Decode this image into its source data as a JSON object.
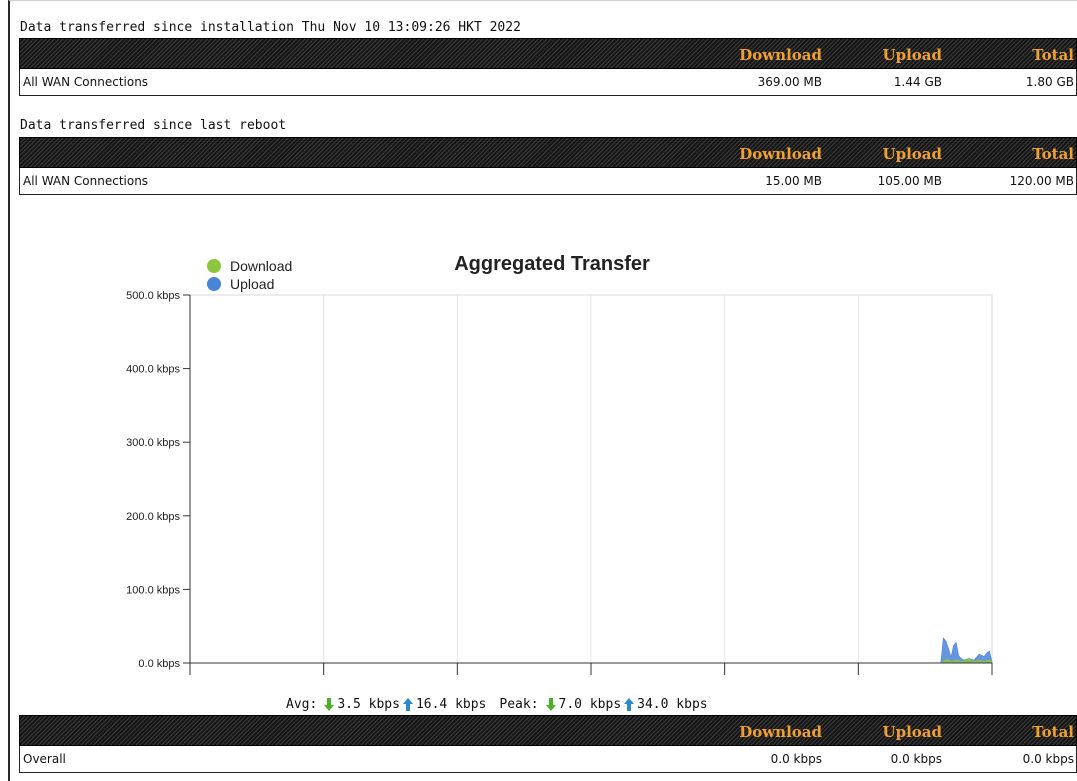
{
  "section1": {
    "caption": "Data transferred since installation Thu Nov 10 13:09:26 HKT 2022",
    "headers": {
      "download": "Download",
      "upload": "Upload",
      "total": "Total"
    },
    "row": {
      "label": "All WAN Connections",
      "download": "369.00 MB",
      "upload": "1.44 GB",
      "total": "1.80 GB"
    }
  },
  "section2": {
    "caption": "Data transferred since last reboot",
    "headers": {
      "download": "Download",
      "upload": "Upload",
      "total": "Total"
    },
    "row": {
      "label": "All WAN Connections",
      "download": "15.00 MB",
      "upload": "105.00 MB",
      "total": "120.00 MB"
    }
  },
  "chart_data": {
    "type": "area",
    "title": "Aggregated Transfer",
    "legend_position": "top-left",
    "series": [
      {
        "name": "Download",
        "color": "#8cc63f",
        "values": [
          0,
          0,
          0,
          0,
          0,
          0,
          0,
          0,
          0,
          0,
          0,
          0,
          0,
          0,
          0,
          0,
          0,
          0,
          0,
          0,
          0,
          0,
          0,
          0,
          0,
          0,
          0,
          0,
          0,
          0,
          0,
          0,
          0,
          0,
          0,
          0,
          0,
          0,
          0,
          0,
          0,
          0,
          0,
          0,
          0,
          0,
          0,
          0,
          0,
          0,
          0,
          0,
          0,
          0,
          0,
          0,
          0,
          0,
          0,
          0,
          0,
          0,
          0,
          0,
          0,
          0,
          0,
          0,
          0,
          0,
          0,
          0,
          0,
          0,
          0,
          0,
          0,
          0,
          0,
          0,
          0,
          0,
          0,
          0,
          0,
          0,
          0,
          0,
          0,
          0,
          0,
          0,
          0,
          0,
          0,
          0,
          0,
          0,
          0,
          0,
          0,
          0,
          0,
          0,
          0,
          0,
          0,
          0,
          0,
          0,
          0,
          0,
          0,
          0,
          0,
          0,
          0,
          0,
          0,
          0,
          0,
          0,
          0,
          0,
          0,
          0,
          0,
          0,
          0,
          0,
          0,
          0,
          0,
          0,
          0,
          0,
          0,
          0,
          0,
          0,
          0,
          0,
          0,
          0,
          0,
          0,
          0,
          0,
          0,
          0,
          0,
          0,
          0,
          0,
          0,
          0,
          0,
          0,
          0,
          0,
          0,
          0,
          0,
          0,
          0,
          0,
          0,
          0,
          0,
          0,
          0,
          0,
          0,
          0,
          0,
          0,
          0,
          0,
          0,
          0,
          0,
          0,
          0,
          0,
          0,
          0,
          0,
          0,
          0,
          0,
          0,
          0,
          0,
          0,
          0,
          0,
          0,
          0,
          0,
          0,
          0,
          0,
          0,
          0,
          0,
          0,
          0,
          0,
          0,
          0,
          0,
          0,
          0,
          0,
          0,
          0,
          0,
          0,
          0,
          0,
          0,
          0,
          0,
          0,
          0,
          0,
          0,
          0,
          0,
          0,
          0,
          0,
          0,
          0,
          0,
          0,
          0,
          0,
          0,
          0,
          0,
          0,
          0,
          0,
          0,
          0,
          0,
          0,
          0,
          0,
          0,
          0,
          0,
          0,
          0,
          0,
          0,
          0,
          0,
          0,
          0,
          0,
          0,
          0,
          0,
          0,
          0,
          0,
          0,
          0,
          0,
          0,
          0,
          0,
          0,
          0,
          0,
          0,
          0,
          0,
          0,
          0,
          0,
          0,
          0,
          0,
          0,
          0,
          0,
          0,
          0,
          0,
          0,
          0,
          0,
          0,
          0,
          0,
          3,
          5,
          4,
          2,
          3,
          4,
          3,
          2,
          3,
          4,
          7,
          3,
          2,
          3,
          4,
          3,
          2,
          3,
          4,
          3
        ]
      },
      {
        "name": "Upload",
        "color": "#4a84d8",
        "values": [
          0,
          0,
          0,
          0,
          0,
          0,
          0,
          0,
          0,
          0,
          0,
          0,
          0,
          0,
          0,
          0,
          0,
          0,
          0,
          0,
          0,
          0,
          0,
          0,
          0,
          0,
          0,
          0,
          0,
          0,
          0,
          0,
          0,
          0,
          0,
          0,
          0,
          0,
          0,
          0,
          0,
          0,
          0,
          0,
          0,
          0,
          0,
          0,
          0,
          0,
          0,
          0,
          0,
          0,
          0,
          0,
          0,
          0,
          0,
          0,
          0,
          0,
          0,
          0,
          0,
          0,
          0,
          0,
          0,
          0,
          0,
          0,
          0,
          0,
          0,
          0,
          0,
          0,
          0,
          0,
          0,
          0,
          0,
          0,
          0,
          0,
          0,
          0,
          0,
          0,
          0,
          0,
          0,
          0,
          0,
          0,
          0,
          0,
          0,
          0,
          0,
          0,
          0,
          0,
          0,
          0,
          0,
          0,
          0,
          0,
          0,
          0,
          0,
          0,
          0,
          0,
          0,
          0,
          0,
          0,
          0,
          0,
          0,
          0,
          0,
          0,
          0,
          0,
          0,
          0,
          0,
          0,
          0,
          0,
          0,
          0,
          0,
          0,
          0,
          0,
          0,
          0,
          0,
          0,
          0,
          0,
          0,
          0,
          0,
          0,
          0,
          0,
          0,
          0,
          0,
          0,
          0,
          0,
          0,
          0,
          0,
          0,
          0,
          0,
          0,
          0,
          0,
          0,
          0,
          0,
          0,
          0,
          0,
          0,
          0,
          0,
          0,
          0,
          0,
          0,
          0,
          0,
          0,
          0,
          0,
          0,
          0,
          0,
          0,
          0,
          0,
          0,
          0,
          0,
          0,
          0,
          0,
          0,
          0,
          0,
          0,
          0,
          0,
          0,
          0,
          0,
          0,
          0,
          0,
          0,
          0,
          0,
          0,
          0,
          0,
          0,
          0,
          0,
          0,
          0,
          0,
          0,
          0,
          0,
          0,
          0,
          0,
          0,
          0,
          0,
          0,
          0,
          0,
          0,
          0,
          0,
          0,
          0,
          0,
          0,
          0,
          0,
          0,
          0,
          0,
          0,
          0,
          0,
          0,
          0,
          0,
          0,
          0,
          0,
          0,
          0,
          0,
          0,
          0,
          0,
          0,
          0,
          0,
          0,
          0,
          0,
          0,
          0,
          0,
          0,
          0,
          0,
          0,
          0,
          0,
          0,
          0,
          0,
          0,
          0,
          0,
          0,
          0,
          0,
          0,
          0,
          0,
          0,
          0,
          0,
          0,
          0,
          0,
          0,
          34,
          30,
          20,
          8,
          24,
          28,
          10,
          6,
          4,
          5,
          6,
          5,
          4,
          8,
          12,
          10,
          9,
          14,
          16,
          2
        ]
      }
    ],
    "y_ticks": [
      "500.0 kbps",
      "400.0 kbps",
      "300.0 kbps",
      "200.0 kbps",
      "100.0 kbps",
      "0.0 kbps"
    ],
    "ylim": [
      0,
      500
    ],
    "grid": "vertical"
  },
  "stats": {
    "avg_label": "Avg:",
    "avg_download": "3.5 kbps",
    "avg_upload": "16.4 kbps",
    "peak_label": "Peak:",
    "peak_download": "7.0 kbps",
    "peak_upload": "34.0 kbps",
    "download_color": "#4caf28",
    "upload_color": "#2a8ad0"
  },
  "section3": {
    "headers": {
      "download": "Download",
      "upload": "Upload",
      "total": "Total"
    },
    "row": {
      "label": "Overall",
      "download": "0.0 kbps",
      "upload": "0.0 kbps",
      "total": "0.0 kbps"
    }
  }
}
